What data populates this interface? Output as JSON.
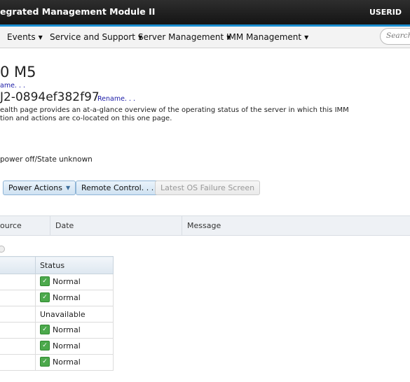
{
  "header": {
    "app_title": "egrated Management Module II",
    "user": "USERID"
  },
  "nav": {
    "items": [
      {
        "label": "Events"
      },
      {
        "label": "Service and Support"
      },
      {
        "label": "Server Management"
      },
      {
        "label": "IMM Management"
      }
    ],
    "search_placeholder": "Search..."
  },
  "summary": {
    "server_model": "0 M5",
    "rename_model": "ame. . .",
    "system_name": "J2-0894ef382f97",
    "rename_system": "Rename. . .",
    "description_lines": [
      "ealth page provides an at-a-glance overview of the operating status of the server in which this IMM",
      "tion and actions are co-located on this one page."
    ],
    "power_state": "power off/State unknown"
  },
  "actions": {
    "power_actions": "Power Actions",
    "remote_control": "Remote Control. . .",
    "latest_os_failure": "Latest OS Failure Screen"
  },
  "events_table": {
    "columns": [
      "ource",
      "Date",
      "Message"
    ]
  },
  "hardware_health": {
    "status_header": "Status",
    "rows": [
      {
        "status": "Normal",
        "icon": "check-icon"
      },
      {
        "status": "Normal",
        "icon": "check-icon"
      },
      {
        "status": "Unavailable",
        "icon": ""
      },
      {
        "status": "Normal",
        "icon": "check-icon"
      },
      {
        "status": "Normal",
        "icon": "check-icon"
      },
      {
        "status": "Normal",
        "icon": "check-icon"
      }
    ]
  },
  "colors": {
    "accent": "#1b8fd1",
    "link": "#1a1aa6",
    "normal_status": "#4ca94c"
  }
}
